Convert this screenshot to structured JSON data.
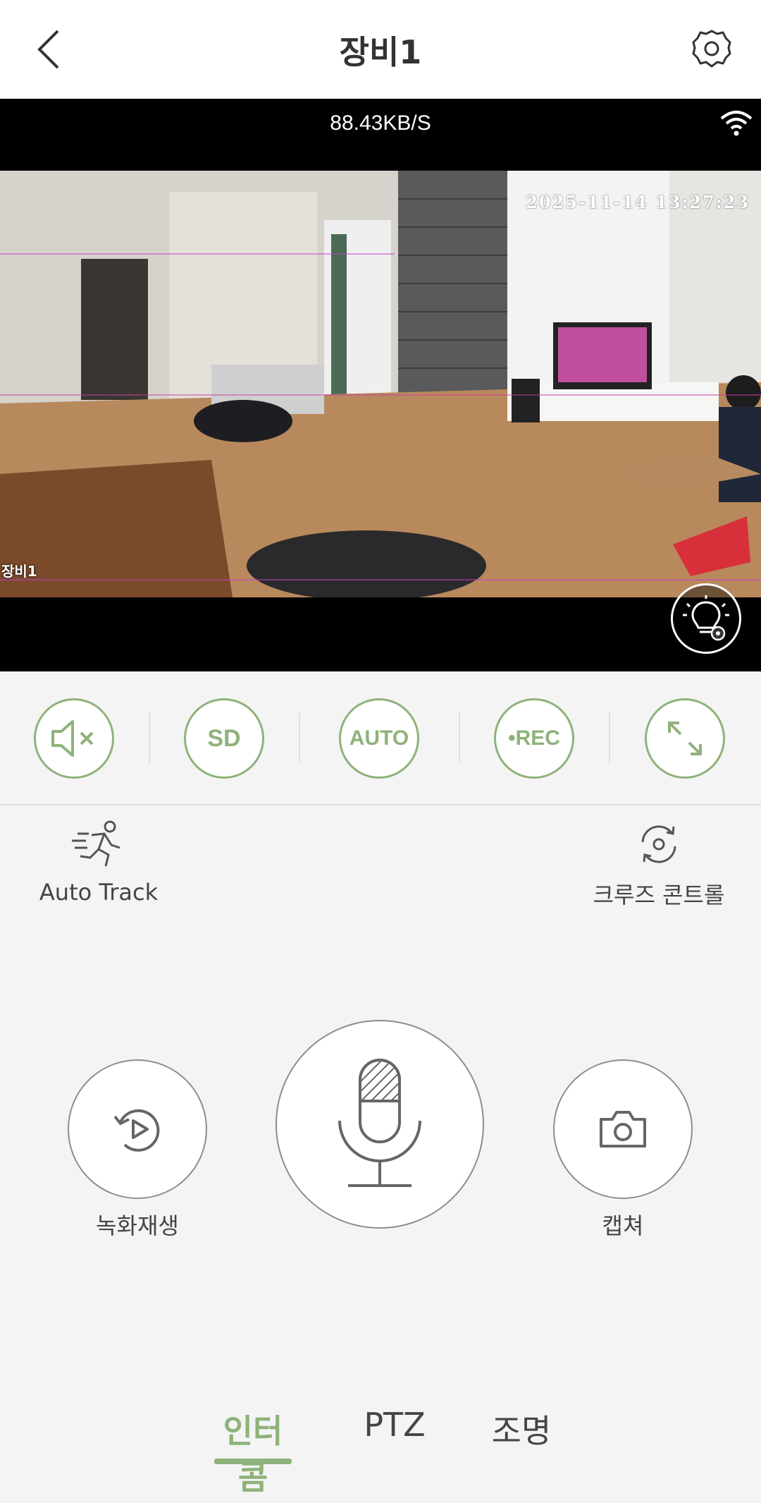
{
  "header": {
    "title": "장비1"
  },
  "video": {
    "speed": "88.43KB/S",
    "timestamp": "2025-11-14  13:27:23",
    "camera_label": "장비1"
  },
  "controls": [
    {
      "name": "mute-button",
      "label": "",
      "icon": "speaker-muted-icon"
    },
    {
      "name": "sd-button",
      "label": "SD"
    },
    {
      "name": "auto-button",
      "label": "AUTO"
    },
    {
      "name": "rec-button",
      "label": "•REC"
    },
    {
      "name": "fullscreen-button",
      "label": "",
      "icon": "expand-icon"
    }
  ],
  "features": {
    "auto_track": "Auto Track",
    "cruise_control": "크루즈 콘트롤"
  },
  "actions": {
    "playback": "녹화재생",
    "capture": "캡쳐"
  },
  "tabs": {
    "intercom": "인터콤",
    "ptz": "PTZ",
    "lighting": "조명"
  },
  "colors": {
    "accent": "#8fb27a",
    "header_bg": "#ffffff",
    "video_bg": "#000000",
    "panel_bg": "#f4f4f4"
  }
}
